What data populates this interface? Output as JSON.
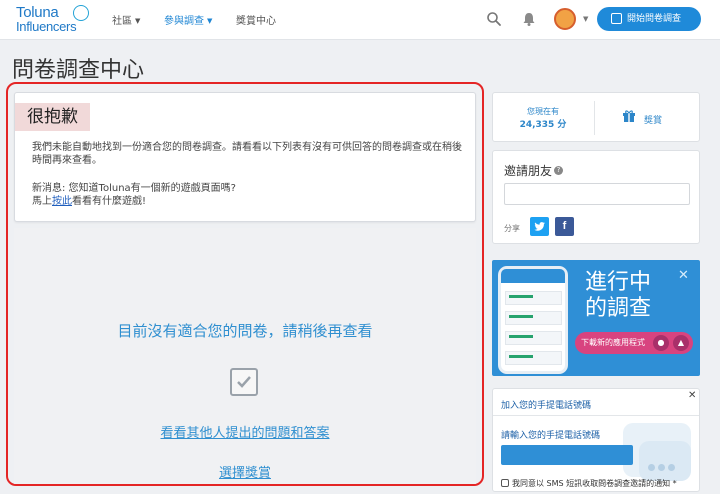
{
  "header": {
    "logo_line1": "Toluna",
    "logo_line2": "Influencers",
    "nav": [
      {
        "label": "社區",
        "has_caret": true
      },
      {
        "label": "參與調查",
        "has_caret": true
      },
      {
        "label": "獎賞中心",
        "has_caret": false
      }
    ],
    "start_button": "開始問卷調查"
  },
  "page_title": "問卷調查中心",
  "sorry": {
    "title": "很抱歉",
    "message": "我們未能自動地找到一份適合您的問卷調查。請看看以下列表有沒有可供回答的問卷調查或在稍後時間再來查看。",
    "news_line1": "新消息: 您知道Toluna有一個新的遊戲頁面嗎?",
    "news_prefix": "馬上",
    "news_link": "按此",
    "news_suffix": "看看有什麼遊戲!"
  },
  "empty": {
    "message": "目前沒有適合您的問卷，請稍後再查看",
    "qa_link": "看看其他人提出的問題和答案",
    "reward_link": "選擇獎賞"
  },
  "sidebar": {
    "points_label": "您現在有",
    "points_value": "24,335 分",
    "rewards_label": "獎賞",
    "invite_title": "邀請朋友",
    "share_label": "分享",
    "promo_line1": "進行中",
    "promo_line2": "的調查",
    "promo_download": "下載新的應用程式",
    "phone_title": "加入您的手提電話號碼",
    "phone_prompt": "請輸入您的手提電話號碼",
    "phone_consent": "我同意以 SMS 短訊收取問卷調查邀請的通知 *"
  },
  "colors": {
    "accent": "#1f8ad9",
    "highlight_frame": "#e42525",
    "sorry_bg": "#f1d9d9",
    "promo_bg": "#2f8fd6",
    "download_btn": "#d8437f"
  }
}
